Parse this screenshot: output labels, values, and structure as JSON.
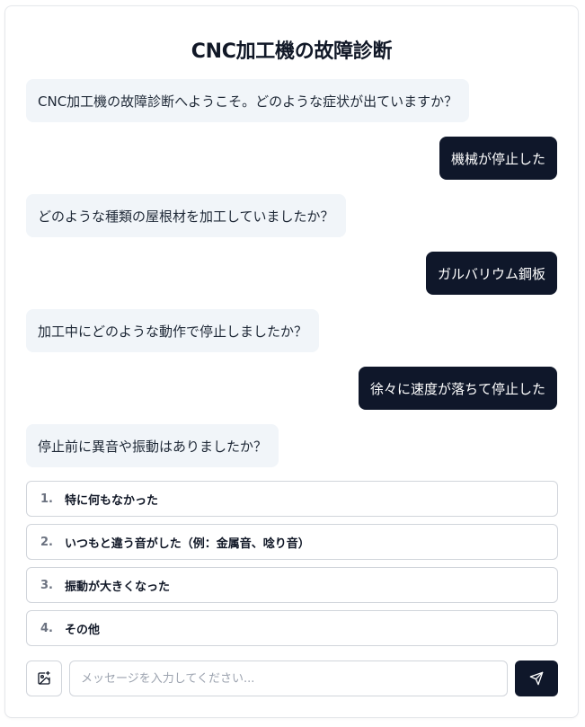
{
  "title": "CNC加工機の故障診断",
  "messages": [
    {
      "role": "bot",
      "text": "CNC加工機の故障診断へようこそ。どのような症状が出ていますか？"
    },
    {
      "role": "user",
      "text": "機械が停止した"
    },
    {
      "role": "bot",
      "text": "どのような種類の屋根材を加工していましたか？"
    },
    {
      "role": "user",
      "text": "ガルバリウム鋼板"
    },
    {
      "role": "bot",
      "text": "加工中にどのような動作で停止しましたか？"
    },
    {
      "role": "user",
      "text": "徐々に速度が落ちて停止した"
    },
    {
      "role": "bot",
      "text": "停止前に異音や振動はありましたか？"
    }
  ],
  "options": [
    {
      "num": "1.",
      "label": "特に何もなかった"
    },
    {
      "num": "2.",
      "label": "いつもと違う音がした（例：金属音、唸り音）"
    },
    {
      "num": "3.",
      "label": "振動が大きくなった"
    },
    {
      "num": "4.",
      "label": "その他"
    }
  ],
  "composer": {
    "placeholder": "メッセージを入力してください...",
    "value": "",
    "image_icon": "image-plus-icon",
    "send_icon": "send-icon"
  },
  "colors": {
    "user_bubble": "#0f172a",
    "bot_bubble": "#f1f5f9",
    "send_button": "#0f172a"
  }
}
